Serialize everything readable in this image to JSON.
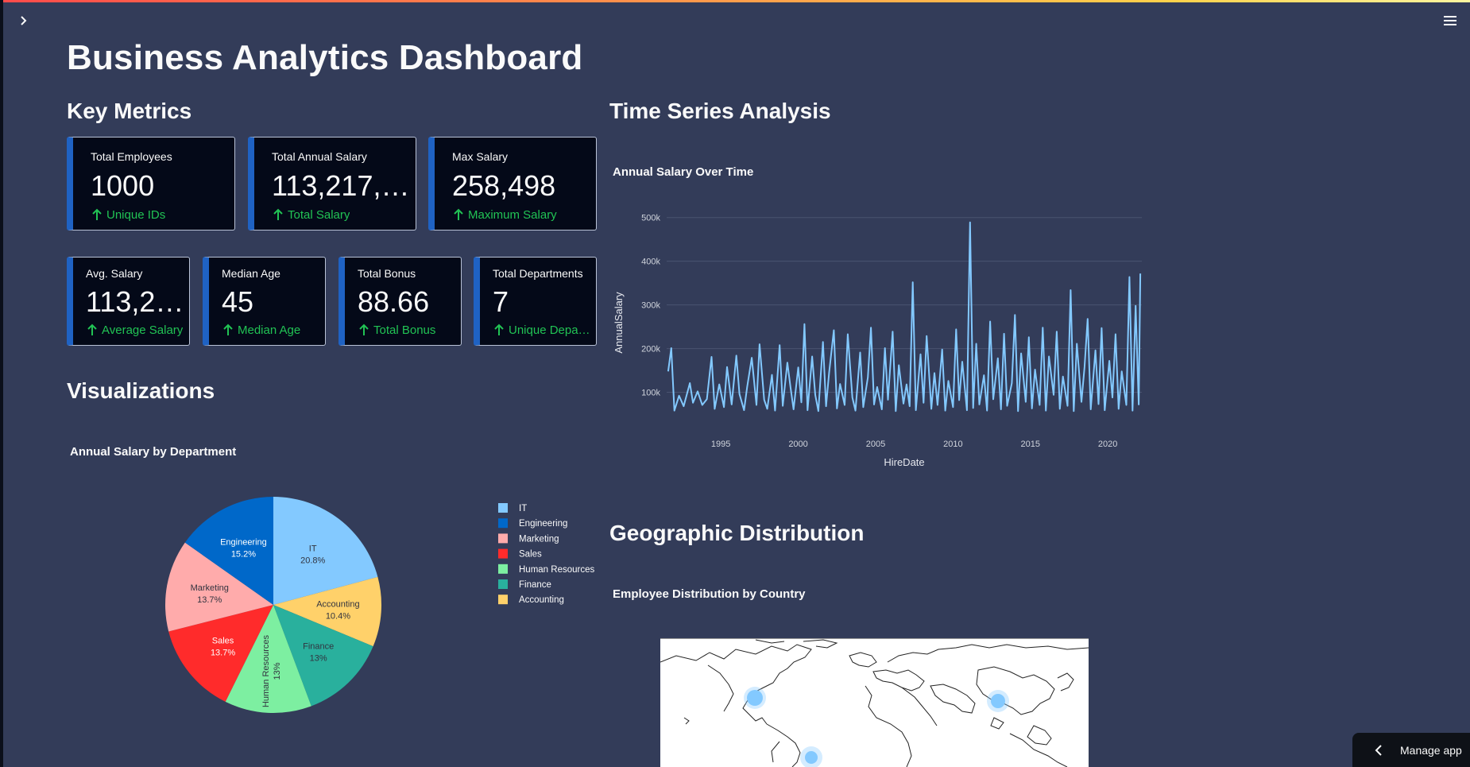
{
  "header": {
    "expand_icon": "chevron-right-icon",
    "menu_icon": "hamburger-menu-icon"
  },
  "page": {
    "title": "Business Analytics Dashboard"
  },
  "sections": {
    "key_metrics": "Key Metrics",
    "visualizations": "Visualizations",
    "time_series": "Time Series Analysis",
    "geographic": "Geographic Distribution"
  },
  "metrics_row1": [
    {
      "label": "Total Employees",
      "value": "1000",
      "delta": "Unique IDs"
    },
    {
      "label": "Total Annual Salary",
      "value": "113,217,…",
      "delta": "Total Salary"
    },
    {
      "label": "Max Salary",
      "value": "258,498",
      "delta": "Maximum Salary"
    }
  ],
  "metrics_row2": [
    {
      "label": "Avg. Salary",
      "value": "113,2…",
      "delta": "Average Salary"
    },
    {
      "label": "Median Age",
      "value": "45",
      "delta": "Median Age"
    },
    {
      "label": "Total Bonus",
      "value": "88.66",
      "delta": "Total Bonus"
    },
    {
      "label": "Total Departments",
      "value": "7",
      "delta": "Unique Depa…"
    }
  ],
  "colors": {
    "background": "#333c59",
    "card_bg": "#040918",
    "card_accent": "#1f62c3",
    "delta_green": "#21c354",
    "line_blue": "#83c9ff"
  },
  "chart_data": [
    {
      "type": "pie",
      "title": "Annual Salary by Department",
      "categories": [
        "IT",
        "Engineering",
        "Marketing",
        "Sales",
        "Human Resources",
        "Finance",
        "Accounting"
      ],
      "values": [
        20.8,
        15.2,
        13.7,
        13.7,
        13,
        13,
        10.4
      ],
      "slice_labels": [
        "20.8%",
        "15.2%",
        "13.7%",
        "13.7%",
        "13%",
        "13%",
        "10.4%"
      ],
      "slice_order": [
        "IT",
        "Accounting",
        "Finance",
        "Human Resources",
        "Sales",
        "Marketing",
        "Engineering"
      ],
      "colors": {
        "IT": "#83c9ff",
        "Engineering": "#0068c9",
        "Marketing": "#ffabab",
        "Sales": "#ff2b2b",
        "Human Resources": "#7defa1",
        "Finance": "#29b09d",
        "Accounting": "#ffd16a"
      },
      "legend": "right"
    },
    {
      "type": "line",
      "title": "Annual Salary Over Time",
      "xlabel": "HireDate",
      "ylabel": "AnnualSalary",
      "x_ticks": [
        "1995",
        "2000",
        "2005",
        "2010",
        "2015",
        "2020"
      ],
      "y_ticks": [
        "100k",
        "200k",
        "300k",
        "400k",
        "500k"
      ],
      "xlim": [
        1991.5,
        2022.2
      ],
      "ylim": [
        30000,
        525000
      ],
      "grid": true,
      "series": [
        {
          "color": "#83c9ff",
          "points": [
            [
              1991.6,
              148000
            ],
            [
              1991.8,
              201000
            ],
            [
              1992.0,
              58000
            ],
            [
              1992.3,
              92000
            ],
            [
              1992.6,
              68000
            ],
            [
              1993.0,
              121000
            ],
            [
              1993.2,
              76000
            ],
            [
              1993.5,
              102000
            ],
            [
              1993.8,
              71000
            ],
            [
              1994.1,
              84000
            ],
            [
              1994.4,
              181000
            ],
            [
              1994.6,
              62000
            ],
            [
              1994.9,
              118000
            ],
            [
              1995.2,
              66000
            ],
            [
              1995.4,
              158000
            ],
            [
              1995.7,
              72000
            ],
            [
              1996.0,
              184000
            ],
            [
              1996.2,
              96000
            ],
            [
              1996.5,
              59000
            ],
            [
              1996.7,
              112000
            ],
            [
              1997.0,
              179000
            ],
            [
              1997.3,
              71000
            ],
            [
              1997.5,
              210000
            ],
            [
              1997.8,
              83000
            ],
            [
              1998.0,
              62000
            ],
            [
              1998.3,
              140000
            ],
            [
              1998.5,
              58000
            ],
            [
              1998.8,
              208000
            ],
            [
              1999.0,
              69000
            ],
            [
              1999.3,
              168000
            ],
            [
              1999.5,
              112000
            ],
            [
              1999.7,
              61000
            ],
            [
              2000.0,
              157000
            ],
            [
              2000.2,
              77000
            ],
            [
              2000.4,
              256000
            ],
            [
              2000.6,
              59000
            ],
            [
              2000.9,
              182000
            ],
            [
              2001.1,
              94000
            ],
            [
              2001.3,
              57000
            ],
            [
              2001.6,
              215000
            ],
            [
              2001.8,
              68000
            ],
            [
              2002.0,
              146000
            ],
            [
              2002.3,
              242000
            ],
            [
              2002.5,
              63000
            ],
            [
              2002.7,
              119000
            ],
            [
              2003.0,
              71000
            ],
            [
              2003.2,
              233000
            ],
            [
              2003.5,
              88000
            ],
            [
              2003.7,
              58000
            ],
            [
              2004.0,
              191000
            ],
            [
              2004.2,
              66000
            ],
            [
              2004.5,
              134000
            ],
            [
              2004.7,
              248000
            ],
            [
              2004.9,
              72000
            ],
            [
              2005.1,
              112000
            ],
            [
              2005.4,
              61000
            ],
            [
              2005.6,
              201000
            ],
            [
              2005.8,
              83000
            ],
            [
              2006.1,
              239000
            ],
            [
              2006.3,
              57000
            ],
            [
              2006.5,
              162000
            ],
            [
              2006.8,
              74000
            ],
            [
              2007.0,
              118000
            ],
            [
              2007.2,
              68000
            ],
            [
              2007.4,
              352000
            ],
            [
              2007.6,
              59000
            ],
            [
              2007.9,
              187000
            ],
            [
              2008.1,
              76000
            ],
            [
              2008.3,
              229000
            ],
            [
              2008.6,
              62000
            ],
            [
              2008.8,
              144000
            ],
            [
              2009.0,
              71000
            ],
            [
              2009.3,
              198000
            ],
            [
              2009.5,
              58000
            ],
            [
              2009.7,
              126000
            ],
            [
              2010.0,
              66000
            ],
            [
              2010.2,
              244000
            ],
            [
              2010.4,
              82000
            ],
            [
              2010.6,
              170000
            ],
            [
              2010.9,
              59000
            ],
            [
              2011.1,
              489000
            ],
            [
              2011.3,
              64000
            ],
            [
              2011.5,
              211000
            ],
            [
              2011.7,
              72000
            ],
            [
              2012.0,
              139000
            ],
            [
              2012.2,
              58000
            ],
            [
              2012.4,
              262000
            ],
            [
              2012.6,
              84000
            ],
            [
              2012.9,
              178000
            ],
            [
              2013.1,
              61000
            ],
            [
              2013.3,
              234000
            ],
            [
              2013.5,
              69000
            ],
            [
              2013.8,
              121000
            ],
            [
              2014.0,
              277000
            ],
            [
              2014.2,
              57000
            ],
            [
              2014.4,
              189000
            ],
            [
              2014.7,
              78000
            ],
            [
              2014.9,
              226000
            ],
            [
              2015.1,
              63000
            ],
            [
              2015.3,
              152000
            ],
            [
              2015.6,
              71000
            ],
            [
              2015.8,
              248000
            ],
            [
              2016.0,
              58000
            ],
            [
              2016.2,
              182000
            ],
            [
              2016.5,
              94000
            ],
            [
              2016.7,
              239000
            ],
            [
              2016.9,
              62000
            ],
            [
              2017.1,
              136000
            ],
            [
              2017.4,
              69000
            ],
            [
              2017.6,
              334000
            ],
            [
              2017.8,
              57000
            ],
            [
              2018.0,
              211000
            ],
            [
              2018.3,
              78000
            ],
            [
              2018.5,
              158000
            ],
            [
              2018.7,
              268000
            ],
            [
              2018.9,
              61000
            ],
            [
              2019.2,
              196000
            ],
            [
              2019.4,
              73000
            ],
            [
              2019.6,
              247000
            ],
            [
              2019.8,
              59000
            ],
            [
              2020.1,
              172000
            ],
            [
              2020.3,
              88000
            ],
            [
              2020.5,
              233000
            ],
            [
              2020.7,
              62000
            ],
            [
              2020.9,
              148000
            ],
            [
              2021.2,
              71000
            ],
            [
              2021.4,
              364000
            ],
            [
              2021.6,
              58000
            ],
            [
              2021.8,
              298000
            ],
            [
              2022.0,
              72000
            ],
            [
              2022.1,
              372000
            ]
          ]
        }
      ]
    }
  ],
  "map": {
    "title": "Employee Distribution by Country",
    "markers": [
      "north-america-marker",
      "east-asia-marker",
      "south-america-marker"
    ]
  },
  "footer": {
    "manage_app_label": "Manage app",
    "manage_app_icon": "chevron-left-icon"
  }
}
